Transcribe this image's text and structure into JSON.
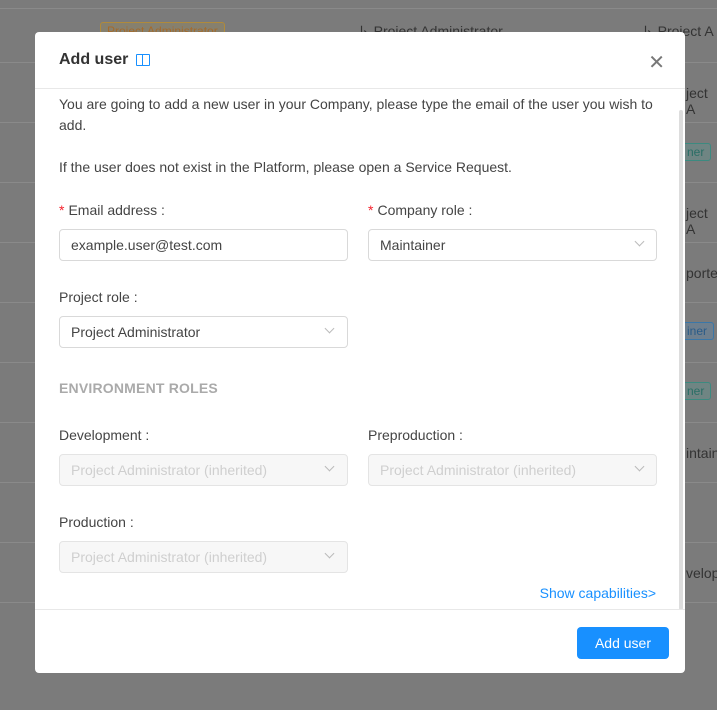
{
  "background": {
    "tag_top": "Project Administrator",
    "col2_top": "Project Administrator",
    "col3_top": "Project A",
    "fragments": [
      "ject A",
      "ner",
      "ject A",
      "porte",
      "iner",
      "ner",
      "intain",
      "velop"
    ]
  },
  "modal": {
    "title": "Add user",
    "intro": "You are going to add a new user in your Company, please type the email of the user you wish to add.",
    "notice": "If the user does not exist in the Platform, please open a Service Request.",
    "email": {
      "required": "*",
      "label": "Email address :",
      "value": "example.user@test.com"
    },
    "company_role": {
      "required": "*",
      "label": "Company role :",
      "value": "Maintainer"
    },
    "project_role": {
      "label": "Project role :",
      "value": "Project Administrator"
    },
    "environment_heading": "ENVIRONMENT ROLES",
    "development": {
      "label": "Development :",
      "value": "Project Administrator (inherited)"
    },
    "preproduction": {
      "label": "Preproduction :",
      "value": "Project Administrator (inherited)"
    },
    "production": {
      "label": "Production :",
      "value": "Project Administrator (inherited)"
    },
    "show_capabilities": "Show capabilities>",
    "submit": "Add user",
    "icons": {
      "docs": "book-icon",
      "close": "close-icon",
      "select": "chevron-down-icon"
    }
  },
  "colors": {
    "primary": "#1890ff",
    "required": "#f5222d"
  }
}
